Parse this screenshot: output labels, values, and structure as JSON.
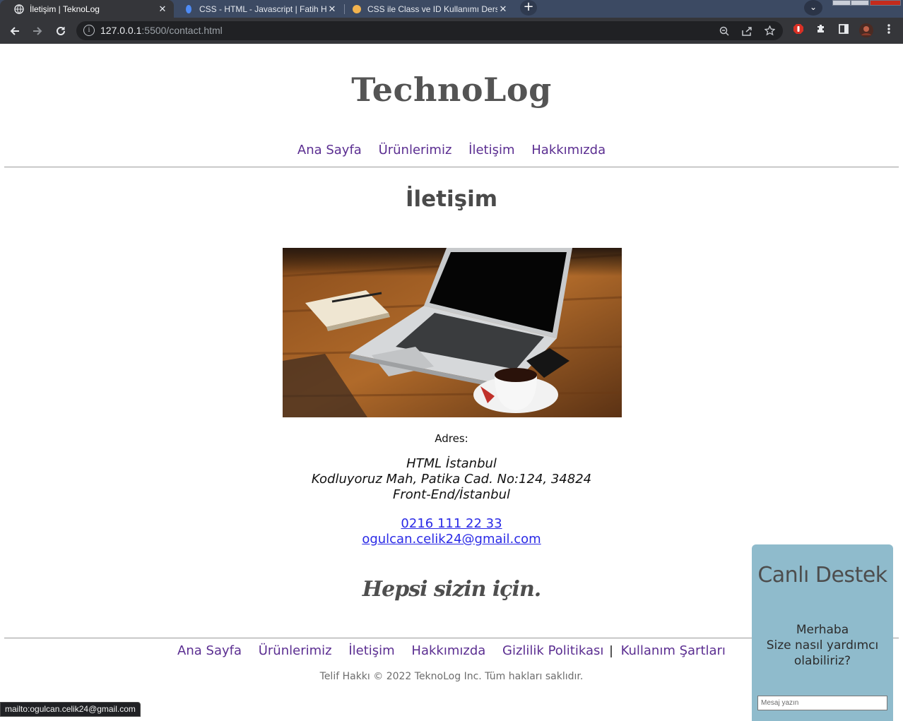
{
  "browser": {
    "tabs": [
      {
        "title": "İletişim | TeknoLog",
        "active": true
      },
      {
        "title": "CSS - HTML - Javascript | Fatih Ha",
        "active": false
      },
      {
        "title": "CSS ile Class ve ID Kullanımı Ders",
        "active": false
      }
    ],
    "tab_close_glyph": "✕",
    "new_tab_glyph": "+",
    "tab_search_glyph": "⌄",
    "url_host": "127.0.0.1",
    "url_rest": ":5500/contact.html",
    "status_url": "mailto:ogulcan.celik24@gmail.com",
    "icons": [
      "back-icon",
      "forward-icon",
      "reload-icon",
      "info-icon",
      "zoom-icon",
      "share-icon",
      "star-icon",
      "adblock-icon",
      "extensions-icon",
      "sidepanel-icon",
      "profile-avatar",
      "menu-icon"
    ]
  },
  "site": {
    "brand": "TechnoLog",
    "nav": [
      "Ana Sayfa",
      "Ürünlerimiz",
      "İletişim",
      "Hakkımızda"
    ],
    "heading": "İletişim",
    "image": "laptop-on-wooden-desk-photo",
    "address_label": "Adres:",
    "address_lines": [
      "HTML İstanbul",
      "Kodluyoruz Mah, Patika Cad. No:124, 34824",
      "Front-End/İstanbul"
    ],
    "phone": "0216 111 22 33",
    "email": "ogulcan.celik24@gmail.com",
    "slogan": "Hepsi sizin için.",
    "footer_nav": [
      "Ana Sayfa",
      "Ürünlerimiz",
      "İletişim",
      "Hakkımızda",
      "Gizlilik Politikası",
      "Kullanım Şartları"
    ],
    "footer_separator": "|",
    "copyright": "Telif Hakkı © 2022 TeknoLog Inc. Tüm hakları saklıdır."
  },
  "chat": {
    "title": "Canlı Destek",
    "message_line1": "Merhaba",
    "message_line2": "Size nasıl yardımcı",
    "message_line3": "olabiliriz?",
    "input_placeholder": "Mesaj yazın"
  },
  "colors": {
    "link": "#5b2e91",
    "contact_link": "#2a2ae6",
    "chat_bg": "#8fbbcc",
    "brand_text": "#545454"
  }
}
